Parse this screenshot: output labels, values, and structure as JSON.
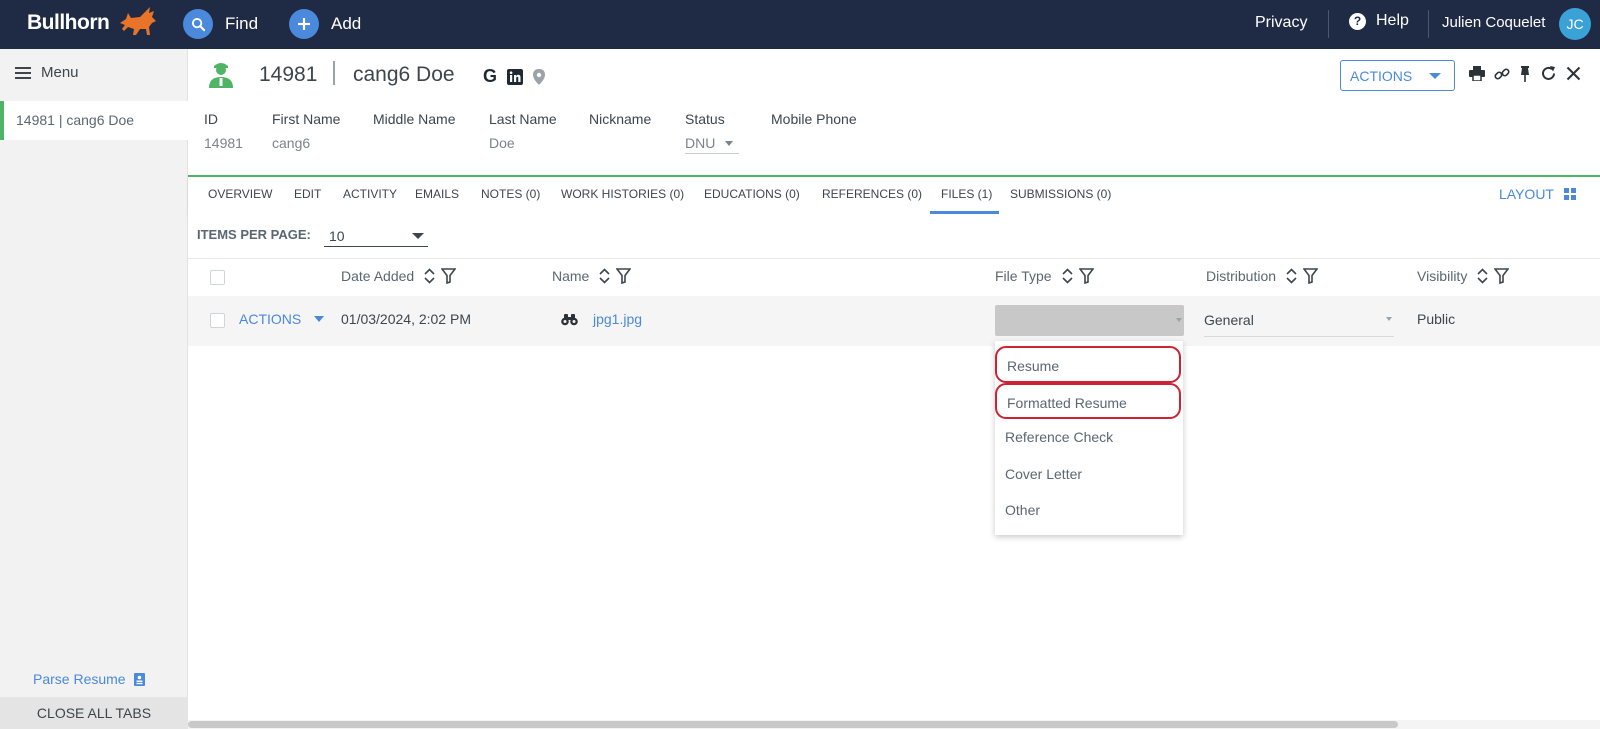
{
  "topbar": {
    "brand": "Bullhorn",
    "find_label": "Find",
    "add_label": "Add",
    "privacy_label": "Privacy",
    "help_label": "Help",
    "user_name": "Julien Coquelet",
    "user_initials": "JC",
    "colors": {
      "background": "#1f2a44",
      "accent": "#4a89dc",
      "logo": "#e8742a"
    }
  },
  "sidebar": {
    "menu_label": "Menu",
    "open_tab": "14981 | cang6 Doe",
    "parse_resume_label": "Parse Resume",
    "close_all_label": "CLOSE ALL TABS"
  },
  "record": {
    "id": "14981",
    "name": "cang6 Doe",
    "actions_label": "ACTIONS",
    "fields": [
      {
        "label": "ID",
        "value": "14981"
      },
      {
        "label": "First Name",
        "value": "cang6"
      },
      {
        "label": "Middle Name",
        "value": ""
      },
      {
        "label": "Last Name",
        "value": "Doe"
      },
      {
        "label": "Nickname",
        "value": ""
      },
      {
        "label": "Status",
        "value": "DNU"
      },
      {
        "label": "Mobile Phone",
        "value": ""
      }
    ]
  },
  "tabs": [
    {
      "label": "OVERVIEW"
    },
    {
      "label": "EDIT"
    },
    {
      "label": "ACTIVITY"
    },
    {
      "label": "EMAILS"
    },
    {
      "label": "NOTES (0)"
    },
    {
      "label": "WORK HISTORIES (0)"
    },
    {
      "label": "EDUCATIONS (0)"
    },
    {
      "label": "REFERENCES (0)"
    },
    {
      "label": "FILES (1)",
      "active": true
    },
    {
      "label": "SUBMISSIONS (0)"
    }
  ],
  "layout_label": "LAYOUT",
  "files": {
    "items_per_page_label": "ITEMS PER PAGE:",
    "items_per_page_value": "10",
    "columns": [
      "Date Added",
      "Name",
      "File Type",
      "Distribution",
      "Visibility"
    ],
    "rows": [
      {
        "actions_label": "ACTIONS",
        "date_added": "01/03/2024, 2:02 PM",
        "name": "jpg1.jpg",
        "file_type": "",
        "distribution": "General",
        "visibility": "Public"
      }
    ],
    "file_type_options": [
      "Resume",
      "Formatted Resume",
      "Reference Check",
      "Cover Letter",
      "Other"
    ],
    "highlighted_options": [
      "Resume",
      "Formatted Resume"
    ]
  }
}
